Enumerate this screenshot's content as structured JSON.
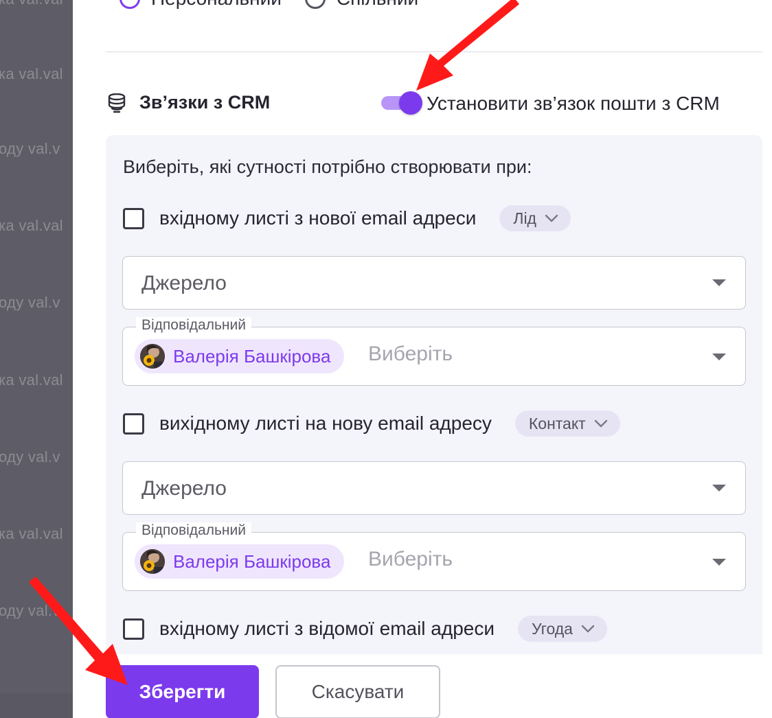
{
  "background": {
    "lines": [
      "ка val.val",
      "оду val.v",
      "ка val.val",
      "оду val.v",
      "ка val.val",
      "оду val.v",
      "ка val.val",
      "оду val.v"
    ]
  },
  "radio_options": [
    {
      "label": "Персональний",
      "selected": true
    },
    {
      "label": "Спільний",
      "selected": false
    }
  ],
  "crm": {
    "icon": "database-icon",
    "title": "Зв’язки з CRM",
    "toggle_label": "Установити зв’язок пошти з CRM",
    "toggle_on": true
  },
  "entities": {
    "heading": "Виберіть, які сутності потрібно створювати при:",
    "rules": [
      {
        "label": "вхідному листі з нової email адреси",
        "checked": false,
        "entity": "Лід",
        "source_placeholder": "Джерело",
        "responsible_label": "Відповідальний",
        "responsible_person": "Валерія Башкірова",
        "responsible_placeholder": "Виберіть"
      },
      {
        "label": "вихідному листі на нову email адресу",
        "checked": false,
        "entity": "Контакт",
        "source_placeholder": "Джерело",
        "responsible_label": "Відповідальний",
        "responsible_person": "Валерія Башкірова",
        "responsible_placeholder": "Виберіть"
      },
      {
        "label": "вхідному листі з відомої email адреси",
        "checked": false,
        "entity": "Угода"
      }
    ]
  },
  "footer": {
    "save_label": "Зберегти",
    "cancel_label": "Скасувати"
  },
  "colors": {
    "accent": "#7c3aed",
    "annotation_arrow": "#ff1a1a",
    "overlay": "#5e5c66"
  }
}
